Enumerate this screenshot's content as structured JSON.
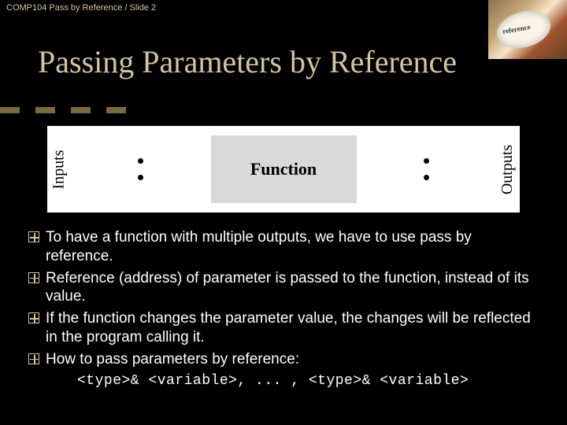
{
  "header": {
    "breadcrumb": "COMP104 Pass by Reference / Slide 2"
  },
  "title": "Passing Parameters by Reference",
  "diagram": {
    "left_label": "Inputs",
    "center_label": "Function",
    "right_label": "Outputs"
  },
  "bullets": [
    "To have a function with multiple outputs, we have to use pass by reference.",
    "Reference (address) of parameter is passed to the function, instead of its value.",
    "If the function changes the parameter value, the changes will be reflected in the program calling it.",
    "How to pass parameters by reference:"
  ],
  "code": "<type>& <variable>, ... , <type>& <variable>"
}
